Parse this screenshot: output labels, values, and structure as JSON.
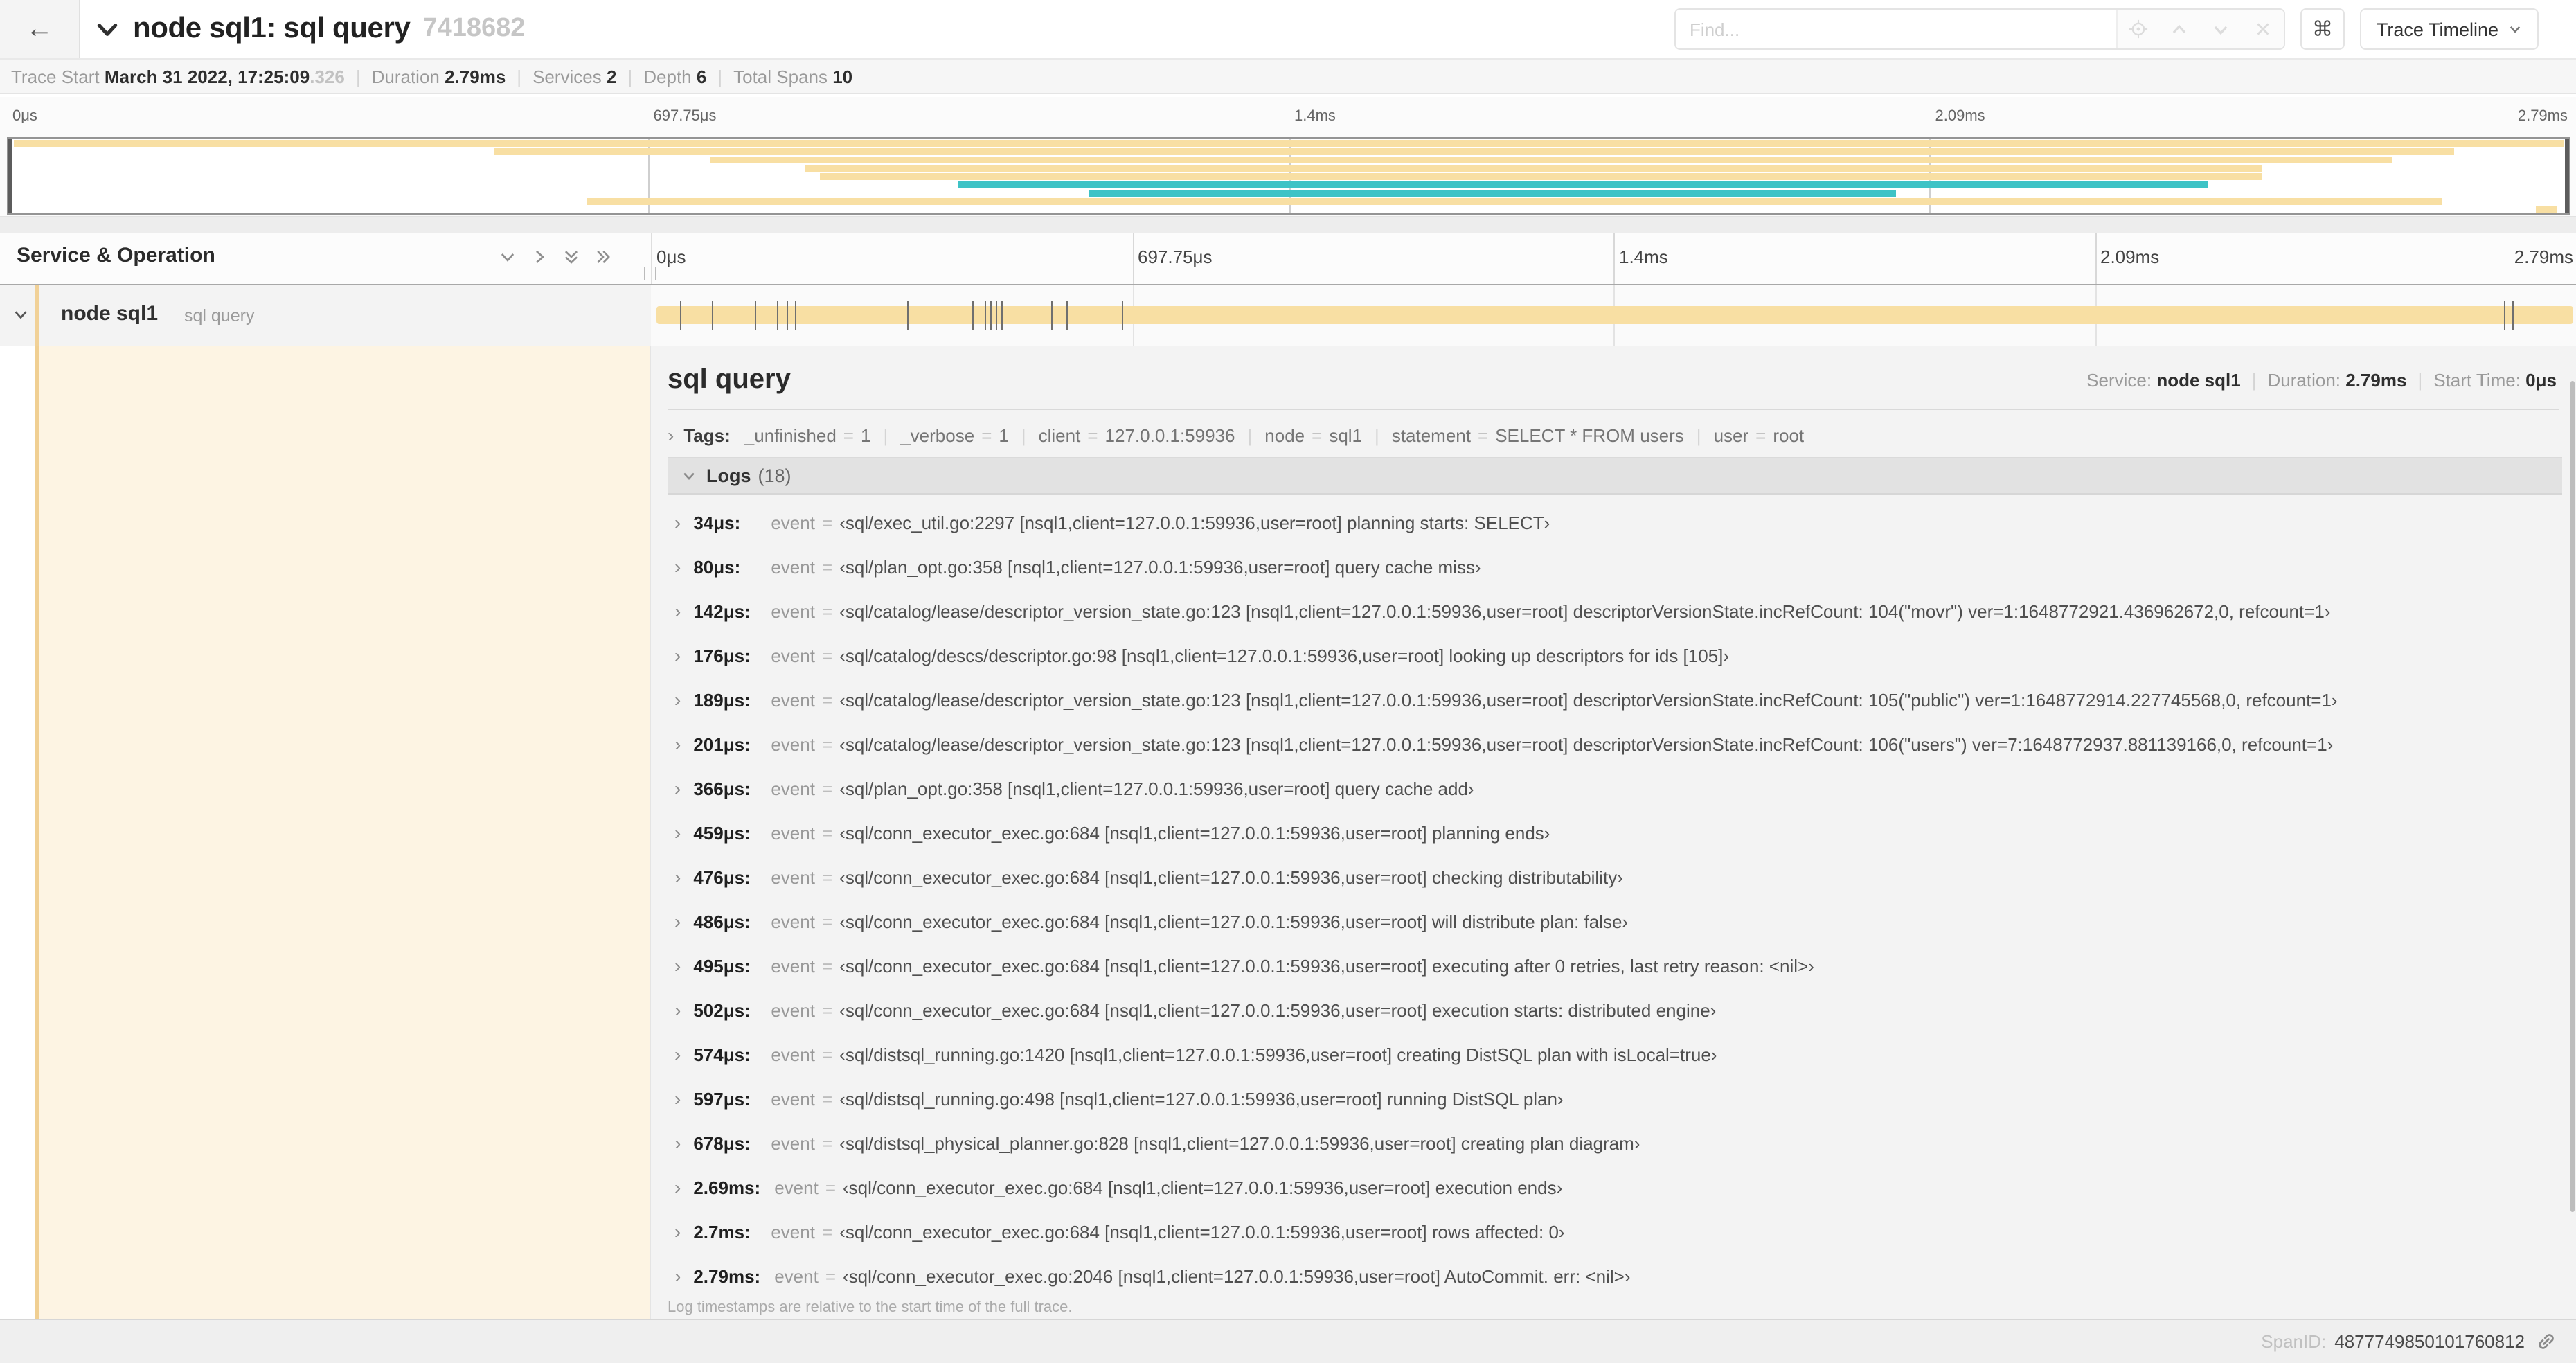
{
  "header": {
    "back_arrow": "←",
    "collapse_chevron": "∨",
    "title": "node sql1: sql query",
    "trace_id": "7418682",
    "find_placeholder": "Find...",
    "shortcut_glyph": "⌘",
    "view_select_label": "Trace Timeline",
    "view_select_caret": "∨"
  },
  "stats": {
    "items": [
      {
        "label": "Trace Start",
        "value": "March 31 2022, 17:25:09",
        "suffix": ".326"
      },
      {
        "label": "Duration",
        "value": "2.79ms"
      },
      {
        "label": "Services",
        "value": "2"
      },
      {
        "label": "Depth",
        "value": "6"
      },
      {
        "label": "Total Spans",
        "value": "10"
      }
    ]
  },
  "timeline": {
    "ticks": [
      {
        "label": "0μs",
        "pos": 0
      },
      {
        "label": "697.75μs",
        "pos": 25
      },
      {
        "label": "1.4ms",
        "pos": 50
      },
      {
        "label": "2.09ms",
        "pos": 75
      },
      {
        "label": "2.79ms",
        "pos": 100
      }
    ],
    "gridline_positions": [
      25,
      50,
      75
    ]
  },
  "minimap": {
    "spans": [
      {
        "row": 0,
        "start": 0.2,
        "width": 99.6,
        "color": "tan"
      },
      {
        "row": 1,
        "start": 19.0,
        "width": 76.5,
        "color": "tan"
      },
      {
        "row": 2,
        "start": 27.4,
        "width": 65.7,
        "color": "tan"
      },
      {
        "row": 3,
        "start": 31.1,
        "width": 56.9,
        "color": "tan"
      },
      {
        "row": 4,
        "start": 31.7,
        "width": 56.3,
        "color": "tan"
      },
      {
        "row": 5,
        "start": 37.1,
        "width": 48.8,
        "color": "teal"
      },
      {
        "row": 6,
        "start": 42.2,
        "width": 31.5,
        "color": "teal"
      },
      {
        "row": 7,
        "start": 22.6,
        "width": 72.4,
        "color": "tan"
      },
      {
        "row": 8,
        "start": 98.7,
        "width": 0.8,
        "color": "tan"
      }
    ]
  },
  "span_list": {
    "header": "Service & Operation",
    "row": {
      "service": "node sql1",
      "operation": "sql query"
    },
    "log_marks": [
      1.2,
      2.9,
      5.1,
      6.3,
      6.8,
      7.2,
      13.1,
      16.5,
      17.1,
      17.4,
      17.7,
      18.0,
      20.6,
      21.4,
      24.3,
      96.4,
      96.8
    ]
  },
  "detail": {
    "title": "sql query",
    "meta": [
      {
        "label": "Service:",
        "value": "node sql1"
      },
      {
        "label": "Duration:",
        "value": "2.79ms"
      },
      {
        "label": "Start Time:",
        "value": "0μs"
      }
    ],
    "tags_label": "Tags:",
    "tags": [
      {
        "key": "_unfinished",
        "value": "1"
      },
      {
        "key": "_verbose",
        "value": "1"
      },
      {
        "key": "client",
        "value": "127.0.0.1:59936"
      },
      {
        "key": "node",
        "value": "sql1"
      },
      {
        "key": "statement",
        "value": "SELECT * FROM users"
      },
      {
        "key": "user",
        "value": "root"
      }
    ],
    "logs_label": "Logs",
    "logs_count": "(18)",
    "logs": [
      {
        "time": "34μs:",
        "key": "event",
        "value": "‹sql/exec_util.go:2297 [nsql1,client=127.0.0.1:59936,user=root] planning starts: SELECT›"
      },
      {
        "time": "80μs:",
        "key": "event",
        "value": "‹sql/plan_opt.go:358 [nsql1,client=127.0.0.1:59936,user=root] query cache miss›"
      },
      {
        "time": "142μs:",
        "key": "event",
        "value": "‹sql/catalog/lease/descriptor_version_state.go:123 [nsql1,client=127.0.0.1:59936,user=root] descriptorVersionState.incRefCount: 104(\"movr\") ver=1:1648772921.436962672,0, refcount=1›"
      },
      {
        "time": "176μs:",
        "key": "event",
        "value": "‹sql/catalog/descs/descriptor.go:98 [nsql1,client=127.0.0.1:59936,user=root] looking up descriptors for ids [105]›"
      },
      {
        "time": "189μs:",
        "key": "event",
        "value": "‹sql/catalog/lease/descriptor_version_state.go:123 [nsql1,client=127.0.0.1:59936,user=root] descriptorVersionState.incRefCount: 105(\"public\") ver=1:1648772914.227745568,0, refcount=1›"
      },
      {
        "time": "201μs:",
        "key": "event",
        "value": "‹sql/catalog/lease/descriptor_version_state.go:123 [nsql1,client=127.0.0.1:59936,user=root] descriptorVersionState.incRefCount: 106(\"users\") ver=7:1648772937.881139166,0, refcount=1›"
      },
      {
        "time": "366μs:",
        "key": "event",
        "value": "‹sql/plan_opt.go:358 [nsql1,client=127.0.0.1:59936,user=root] query cache add›"
      },
      {
        "time": "459μs:",
        "key": "event",
        "value": "‹sql/conn_executor_exec.go:684 [nsql1,client=127.0.0.1:59936,user=root] planning ends›"
      },
      {
        "time": "476μs:",
        "key": "event",
        "value": "‹sql/conn_executor_exec.go:684 [nsql1,client=127.0.0.1:59936,user=root] checking distributability›"
      },
      {
        "time": "486μs:",
        "key": "event",
        "value": "‹sql/conn_executor_exec.go:684 [nsql1,client=127.0.0.1:59936,user=root] will distribute plan: false›"
      },
      {
        "time": "495μs:",
        "key": "event",
        "value": "‹sql/conn_executor_exec.go:684 [nsql1,client=127.0.0.1:59936,user=root] executing after 0 retries, last retry reason: <nil>›"
      },
      {
        "time": "502μs:",
        "key": "event",
        "value": "‹sql/conn_executor_exec.go:684 [nsql1,client=127.0.0.1:59936,user=root] execution starts: distributed engine›"
      },
      {
        "time": "574μs:",
        "key": "event",
        "value": "‹sql/distsql_running.go:1420 [nsql1,client=127.0.0.1:59936,user=root] creating DistSQL plan with isLocal=true›"
      },
      {
        "time": "597μs:",
        "key": "event",
        "value": "‹sql/distsql_running.go:498 [nsql1,client=127.0.0.1:59936,user=root] running DistSQL plan›"
      },
      {
        "time": "678μs:",
        "key": "event",
        "value": "‹sql/distsql_physical_planner.go:828 [nsql1,client=127.0.0.1:59936,user=root] creating plan diagram›"
      },
      {
        "time": "2.69ms:",
        "key": "event",
        "value": "‹sql/conn_executor_exec.go:684 [nsql1,client=127.0.0.1:59936,user=root] execution ends›"
      },
      {
        "time": "2.7ms:",
        "key": "event",
        "value": "‹sql/conn_executor_exec.go:684 [nsql1,client=127.0.0.1:59936,user=root] rows affected: 0›"
      },
      {
        "time": "2.79ms:",
        "key": "event",
        "value": "‹sql/conn_executor_exec.go:2046 [nsql1,client=127.0.0.1:59936,user=root] AutoCommit. err: <nil>›"
      }
    ],
    "footnote": "Log timestamps are relative to the start time of the full trace.",
    "span_id_label": "SpanID:",
    "span_id": "4877749850101760812"
  },
  "colors": {
    "tan": "#f8dfa3",
    "teal": "#3ec3c6",
    "stripe": "#f0cf92",
    "cream": "#fdf4e3"
  }
}
